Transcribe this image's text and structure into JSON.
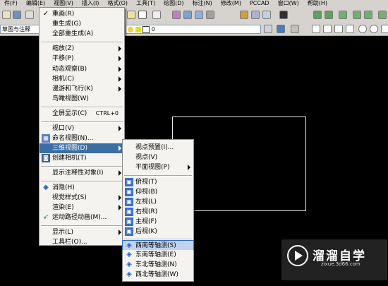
{
  "menubar": [
    "件(F)",
    "编辑(E)",
    "视图(V)",
    "插入(I)",
    "格式(O)",
    "工具(T)",
    "绘图(D)",
    "标注(N)",
    "修改(M)",
    "PCCAD",
    "窗口(W)",
    "帮助(H)"
  ],
  "toolbar": {
    "workspace_combo": "草图与注释",
    "layer_combo": "0"
  },
  "view_menu": {
    "items": [
      {
        "label": "重画(R)",
        "icon": "check-icon"
      },
      {
        "label": "重生成(G)",
        "icon": ""
      },
      {
        "label": "全部重生成(A)",
        "icon": ""
      },
      {
        "label": "缩放(Z)",
        "icon": "",
        "submenu": true
      },
      {
        "label": "平移(P)",
        "icon": "",
        "submenu": true
      },
      {
        "label": "动态观察(B)",
        "icon": "",
        "submenu": true
      },
      {
        "label": "相机(C)",
        "icon": "",
        "submenu": true
      },
      {
        "label": "漫游和飞行(K)",
        "icon": "",
        "submenu": true
      },
      {
        "label": "鸟瞰视图(W)",
        "icon": ""
      },
      {
        "label": "全屏显示(C)",
        "shortcut": "CTRL+0"
      },
      {
        "label": "视口(V)",
        "submenu": true
      },
      {
        "label": "命名视图(N)...",
        "icon": "named-view-icon"
      },
      {
        "label": "三维视图(D)",
        "submenu": true,
        "highlighted": true
      },
      {
        "label": "创建相机(T)",
        "icon": "camera-icon"
      },
      {
        "label": "显示注释性对象(I)",
        "submenu": true
      },
      {
        "label": "消隐(H)",
        "icon": "hide-icon"
      },
      {
        "label": "视觉样式(S)",
        "submenu": true
      },
      {
        "label": "渲染(E)",
        "submenu": true
      },
      {
        "label": "运动路径动画(M)...",
        "icon": "motion-path-icon"
      },
      {
        "label": "显示(L)",
        "submenu": true
      },
      {
        "label": "工具栏(O)..."
      }
    ]
  },
  "view3d_menu": {
    "items": [
      {
        "label": "视点预置(I)..."
      },
      {
        "label": "视点(V)"
      },
      {
        "label": "平面视图(P)",
        "submenu": true
      },
      {
        "label": "俯视(T)",
        "icon": "top-view-icon"
      },
      {
        "label": "仰视(B)",
        "icon": "bottom-view-icon"
      },
      {
        "label": "左视(L)",
        "icon": "left-view-icon"
      },
      {
        "label": "右视(R)",
        "icon": "right-view-icon"
      },
      {
        "label": "主视(F)",
        "icon": "front-view-icon"
      },
      {
        "label": "后视(K)",
        "icon": "back-view-icon"
      },
      {
        "label": "西南等轴测(S)",
        "icon": "sw-iso-icon",
        "selected": true
      },
      {
        "label": "东南等轴测(E)",
        "icon": "se-iso-icon"
      },
      {
        "label": "东北等轴测(N)",
        "icon": "ne-iso-icon"
      },
      {
        "label": "西北等轴测(W)",
        "icon": "nw-iso-icon"
      }
    ]
  },
  "watermark": {
    "title": "溜溜自学",
    "url": "zixue.3d66.com"
  }
}
